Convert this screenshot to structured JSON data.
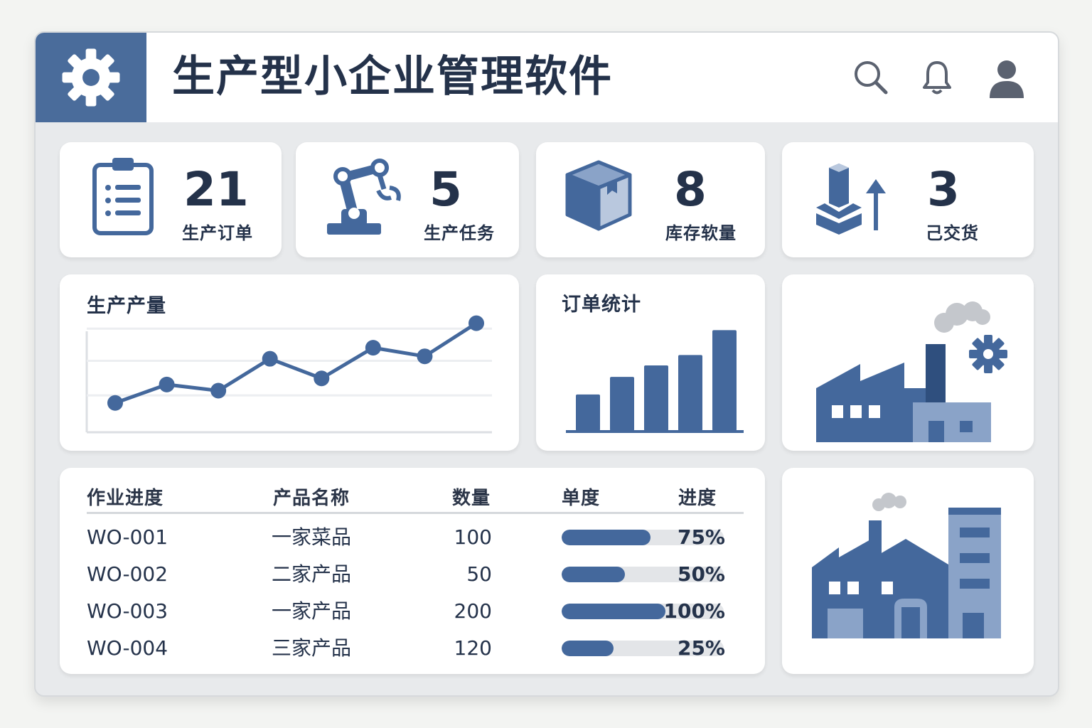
{
  "app": {
    "title": "生产型小企业管理软件"
  },
  "header_icons": [
    "search-icon",
    "bell-icon",
    "user-icon"
  ],
  "stats": [
    {
      "icon": "clipboard-icon",
      "value": "21",
      "label": "生产订单"
    },
    {
      "icon": "robot-arm-icon",
      "value": "5",
      "label": "生产任务"
    },
    {
      "icon": "box-icon",
      "value": "8",
      "label": "库存软量"
    },
    {
      "icon": "delivery-icon",
      "value": "3",
      "label": "己交货"
    }
  ],
  "output_chart": {
    "title": "生产产量",
    "chart_data": {
      "type": "line",
      "values": [
        1.0,
        2.5,
        2.0,
        4.6,
        3.0,
        5.5,
        4.8,
        7.5
      ]
    }
  },
  "order_chart": {
    "title": "订单统计",
    "chart_data": {
      "type": "bar",
      "values": [
        3.5,
        5.2,
        6.3,
        7.3,
        9.7
      ]
    }
  },
  "table": {
    "headers": {
      "job": "作业进度",
      "product": "产品名称",
      "qty": "数量",
      "unit": "单度",
      "progress": "进度"
    },
    "rows": [
      {
        "id": "WO-001",
        "product": "一家菜品",
        "qty": "100",
        "progress": "75%",
        "fraction": 0.55
      },
      {
        "id": "WO-002",
        "product": "二家产品",
        "qty": "50",
        "progress": "50%",
        "fraction": 0.39
      },
      {
        "id": "WO-003",
        "product": "一家产品",
        "qty": "200",
        "progress": "100%",
        "fraction": 0.64
      },
      {
        "id": "WO-004",
        "product": "三家产品",
        "qty": "120",
        "progress": "25%",
        "fraction": 0.32
      }
    ]
  },
  "colors": {
    "brand": "#4a6c9b",
    "bar": "#44689c",
    "accent_light": "#8aa3c8",
    "dark": "#24324a"
  }
}
